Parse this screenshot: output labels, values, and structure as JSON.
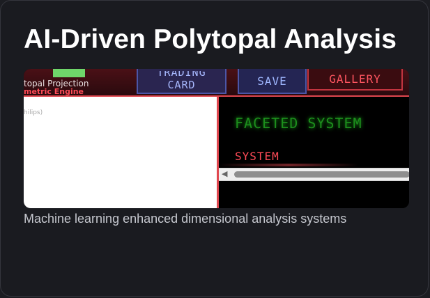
{
  "card": {
    "title": "AI-Driven Polytopal Analysis",
    "caption": "Machine learning enhanced dimensional analysis systems"
  },
  "preview": {
    "topbar": {
      "projection_label": "topal Projection",
      "engine_label": "metric Engine",
      "buttons": {
        "trading_card_line1": "TRADING",
        "trading_card_line2": "CARD",
        "save": "SAVE",
        "gallery": "GALLERY"
      }
    },
    "left_panel": {
      "faint_text": "hilips)"
    },
    "right_panel": {
      "faceted_system": "FACETED SYSTEM",
      "system_label": "SYSTEM"
    }
  }
}
